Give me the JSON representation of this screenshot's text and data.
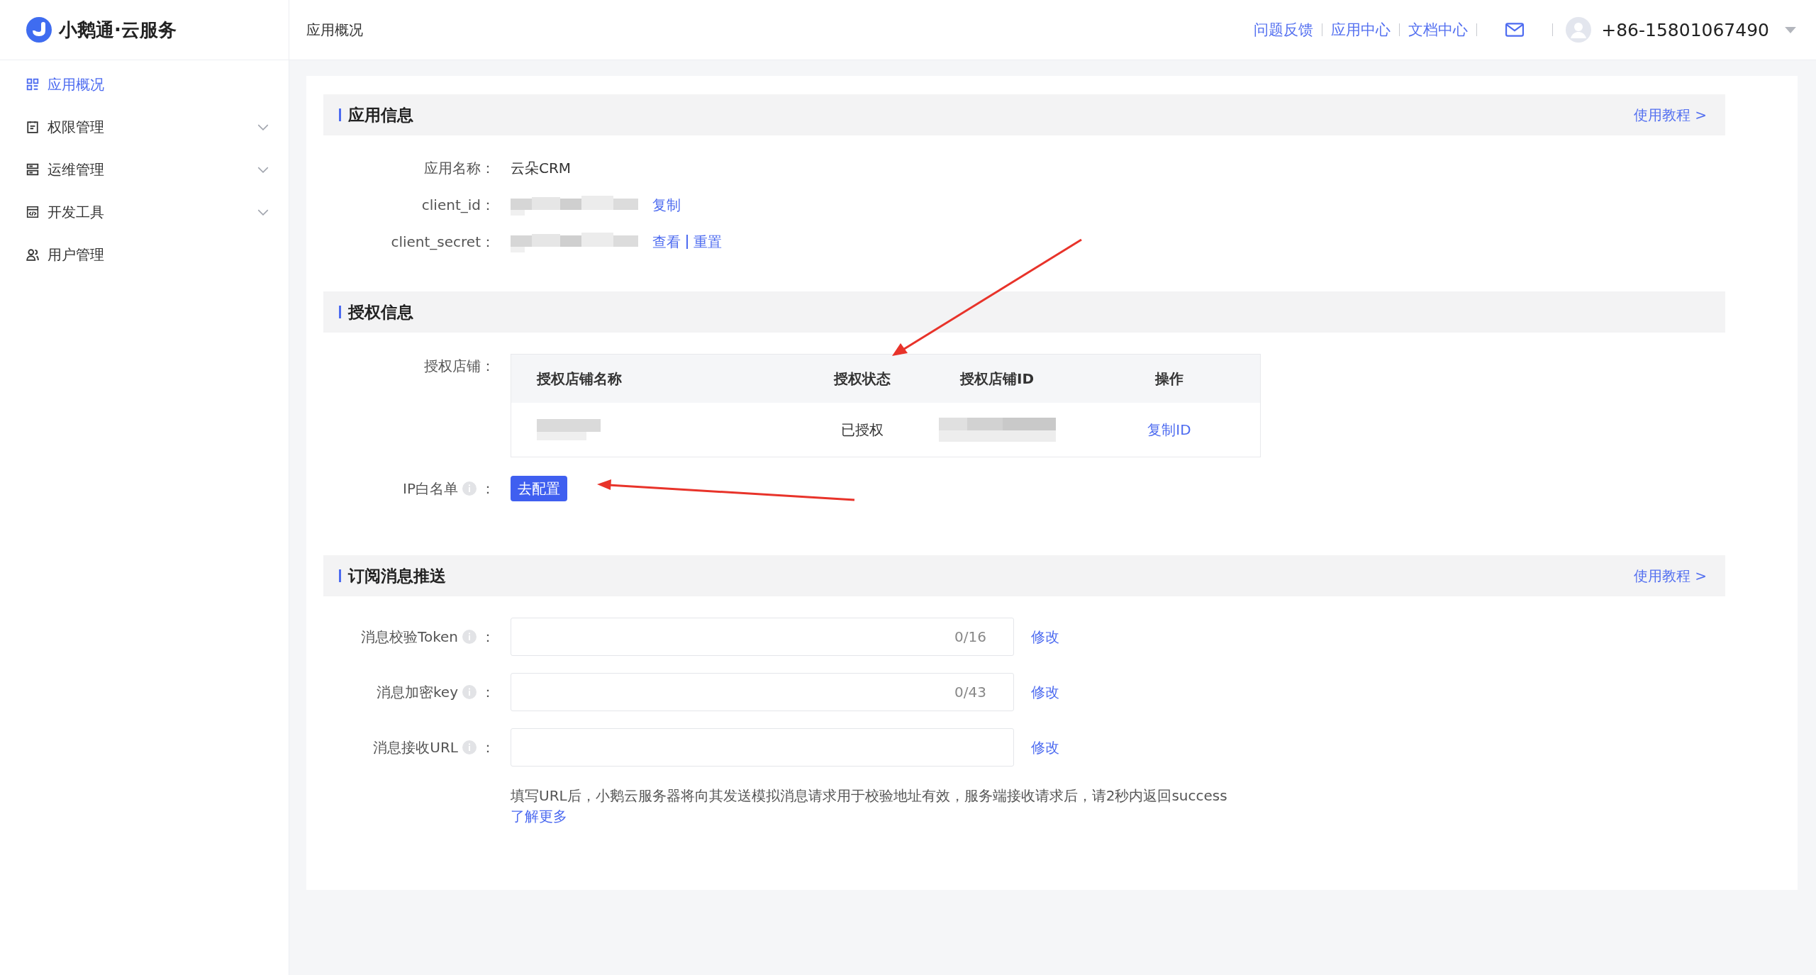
{
  "brand": {
    "name": "小鹅通·云服务"
  },
  "sidebar": {
    "items": [
      {
        "label": "应用概况",
        "selected": true,
        "expandable": false
      },
      {
        "label": "权限管理",
        "selected": false,
        "expandable": true
      },
      {
        "label": "运维管理",
        "selected": false,
        "expandable": true
      },
      {
        "label": "开发工具",
        "selected": false,
        "expandable": true
      },
      {
        "label": "用户管理",
        "selected": false,
        "expandable": false
      }
    ]
  },
  "header": {
    "breadcrumb": "应用概况",
    "links": [
      "问题反馈",
      "应用中心",
      "文档中心"
    ],
    "user": "+86-15801067490"
  },
  "app_info": {
    "title": "应用信息",
    "tutorial_link": "使用教程 >",
    "fields": [
      {
        "label": "应用名称",
        "colon": "：",
        "kind": "text",
        "value": "云朵CRM"
      },
      {
        "label": "client_id",
        "colon": "：",
        "kind": "redacted",
        "actions": [
          "复制"
        ]
      },
      {
        "label": "client_secret",
        "colon": "：",
        "kind": "redacted",
        "actions": [
          "查看",
          "重置"
        ]
      }
    ]
  },
  "auth_info": {
    "title": "授权信息",
    "shops_label": "授权店铺",
    "colon": "：",
    "table": {
      "columns": [
        "授权店铺名称",
        "授权状态",
        "授权店铺ID",
        "操作"
      ],
      "rows": [
        {
          "cells": [
            {
              "kind": "redacted"
            },
            {
              "kind": "text",
              "value": "已授权"
            },
            {
              "kind": "redacted"
            },
            {
              "kind": "link",
              "value": "复制ID"
            }
          ]
        }
      ]
    },
    "ip_whitelist": {
      "label": "IP白名单",
      "info": true,
      "colon": "：",
      "button": "去配置"
    }
  },
  "subscription": {
    "title": "订阅消息推送",
    "tutorial_link": "使用教程 >",
    "fields": [
      {
        "label": "消息校验Token",
        "info": true,
        "colon": "：",
        "counter": "0/16",
        "action": "修改"
      },
      {
        "label": "消息加密key",
        "info": true,
        "colon": "：",
        "counter": "0/43",
        "action": "修改"
      },
      {
        "label": "消息接收URL",
        "info": true,
        "colon": "：",
        "action": "修改"
      }
    ],
    "help": "填写URL后，小鹅云服务器将向其发送模拟消息请求用于校验地址有效，服务端接收请求后，请2秒内返回success",
    "learn_more": "了解更多"
  }
}
